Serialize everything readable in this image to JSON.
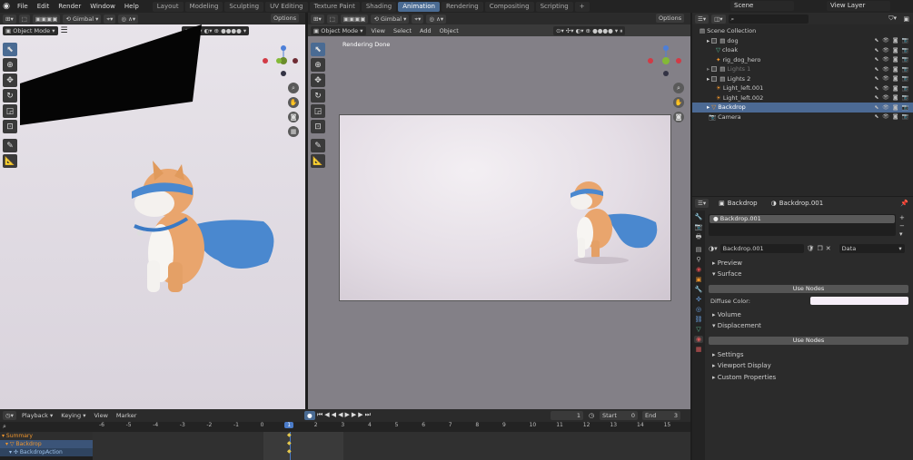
{
  "top_menu": {
    "items": [
      "File",
      "Edit",
      "Render",
      "Window",
      "Help"
    ],
    "workspaces": [
      "Layout",
      "Modeling",
      "Sculpting",
      "UV Editing",
      "Texture Paint",
      "Shading",
      "Animation",
      "Rendering",
      "Compositing",
      "Scripting",
      "+"
    ],
    "active_workspace": "Animation",
    "scene": "Scene",
    "view_layer": "View Layer"
  },
  "left_viewport": {
    "mode": "Object Mode",
    "transform": "Gimbal",
    "options": "Options"
  },
  "camera_viewport": {
    "mode": "Object Mode",
    "menus": [
      "View",
      "Select",
      "Add",
      "Object"
    ],
    "status": "Rendering Done",
    "transform": "Gimbal",
    "options": "Options"
  },
  "outliner": {
    "search_placeholder": "",
    "rows": [
      {
        "label": "Scene Collection",
        "indent": 0,
        "icon": "collection-icon"
      },
      {
        "label": "dog",
        "indent": 1,
        "icon": "collection-icon"
      },
      {
        "label": "cloak",
        "indent": 2,
        "icon": "mesh-icon"
      },
      {
        "label": "rig_dog_hero",
        "indent": 2,
        "icon": "armature-icon"
      },
      {
        "label": "Lights 1",
        "indent": 1,
        "icon": "collection-icon",
        "dim": true
      },
      {
        "label": "Lights 2",
        "indent": 1,
        "icon": "collection-icon"
      },
      {
        "label": "Light_left.001",
        "indent": 2,
        "icon": "light-icon"
      },
      {
        "label": "Light_left.002",
        "indent": 2,
        "icon": "light-icon"
      },
      {
        "label": "Backdrop",
        "indent": 1,
        "icon": "mesh-icon",
        "selected": true
      },
      {
        "label": "Camera",
        "indent": 1,
        "icon": "camera-icon"
      }
    ]
  },
  "properties": {
    "object": "Backdrop",
    "material": "Backdrop.001",
    "slot": "Backdrop.001",
    "mat_field": "Backdrop.001",
    "data_select": "Data",
    "preview": "Preview",
    "surface": "Surface",
    "use_nodes": "Use Nodes",
    "diffuse_label": "Diffuse Color:",
    "diffuse_color": "#f6eef8",
    "volume": "Volume",
    "displacement": "Displacement",
    "use_nodes2": "Use Nodes",
    "settings": "Settings",
    "viewport_display": "Viewport Display",
    "custom_properties": "Custom Properties"
  },
  "timeline": {
    "menus": [
      "Playback",
      "Keying",
      "View",
      "Marker"
    ],
    "frame": "1",
    "start_label": "Start",
    "start": "0",
    "end_label": "End",
    "end": "3",
    "ticks": [
      "-6",
      "-5",
      "-4",
      "-3",
      "-2",
      "-1",
      "0",
      "1",
      "2",
      "3",
      "4",
      "5",
      "6",
      "7",
      "8",
      "9",
      "10",
      "11",
      "12",
      "13",
      "14",
      "15"
    ],
    "current": "1",
    "channels": [
      "Summary",
      "Backdrop",
      "BackdropAction"
    ]
  },
  "colors": {
    "accent": "#4a6b93",
    "selected_row": "#4c6a94",
    "orange": "#f0962d",
    "timeline_current": "#4a7bc8"
  }
}
